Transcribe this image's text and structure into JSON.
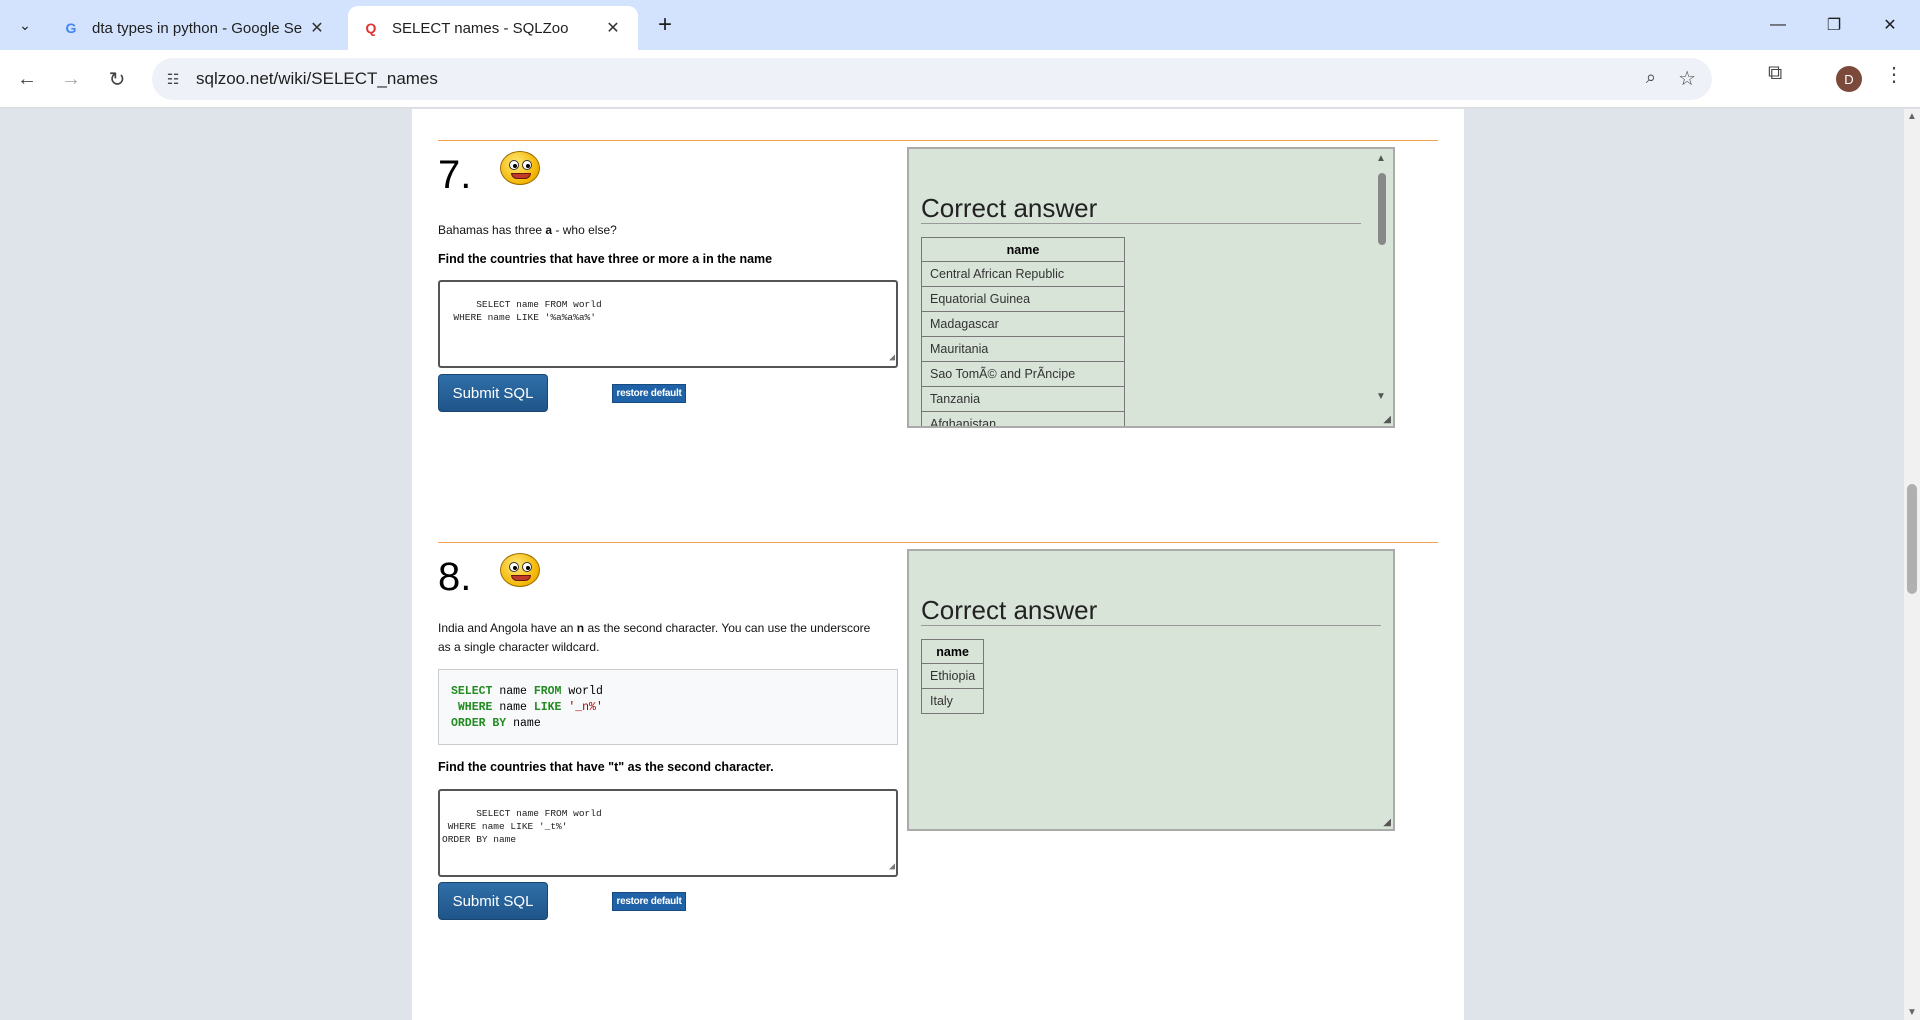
{
  "browser": {
    "tabs": [
      {
        "label": "dta types in python - Google Se",
        "favicon": "G"
      },
      {
        "label": "SELECT names - SQLZoo",
        "favicon": "Q"
      }
    ],
    "url": "sqlzoo.net/wiki/SELECT_names",
    "profile_initial": "D",
    "icons": {
      "tab_search": "chevron-down-icon",
      "close": "close-icon",
      "new_tab": "plus-icon",
      "back": "arrow-left-icon",
      "forward": "arrow-right-icon",
      "reload": "reload-icon",
      "site_info": "tune-icon",
      "zoom": "zoom-icon",
      "bookmark": "star-icon",
      "extensions": "puzzle-icon",
      "menu": "kebab-icon"
    }
  },
  "q7": {
    "number": "7.",
    "intro_pre": "Bahamas has three ",
    "intro_bold": "a",
    "intro_post": " - who else?",
    "task": "Find the countries that have three or more a in the name",
    "sql": "SELECT name FROM world\n  WHERE name LIKE '%a%a%a%'",
    "submit_label": "Submit SQL",
    "restore_label": "restore default",
    "answer_title": "Correct answer",
    "answer_header": "name",
    "answer_rows": [
      "Central African Republic",
      "Equatorial Guinea",
      "Madagascar",
      "Mauritania",
      "Sao TomÃ© and PrÃncipe",
      "Tanzania",
      "Afghanistan"
    ]
  },
  "q8": {
    "number": "8.",
    "intro_line1_pre": "India and Angola have an ",
    "intro_line1_bold": "n",
    "intro_line1_post": " as the second character. You can use the underscore",
    "intro_line2": "as a single character wildcard.",
    "example": {
      "line1_kw1": "SELECT",
      "line1_mid": " name ",
      "line1_kw2": "FROM",
      "line1_end": " world",
      "line2_kw1": " WHERE",
      "line2_mid": " name ",
      "line2_kw2": "LIKE",
      "line2_str": " '_n%'",
      "line3_kw": "ORDER BY",
      "line3_end": " name"
    },
    "task": "Find the countries that have \"t\" as the second character.",
    "sql": "SELECT name FROM world\n WHERE name LIKE '_t%'\nORDER BY name",
    "submit_label": "Submit SQL",
    "restore_label": "restore default",
    "answer_title": "Correct answer",
    "answer_header": "name",
    "answer_rows": [
      "Ethiopia",
      "Italy"
    ]
  },
  "colors": {
    "rule": "#f0a050",
    "answer_bg": "#d9e4d9",
    "submit_bg": "#1f5589",
    "keyword": "#228b22",
    "string": "#b00000"
  }
}
